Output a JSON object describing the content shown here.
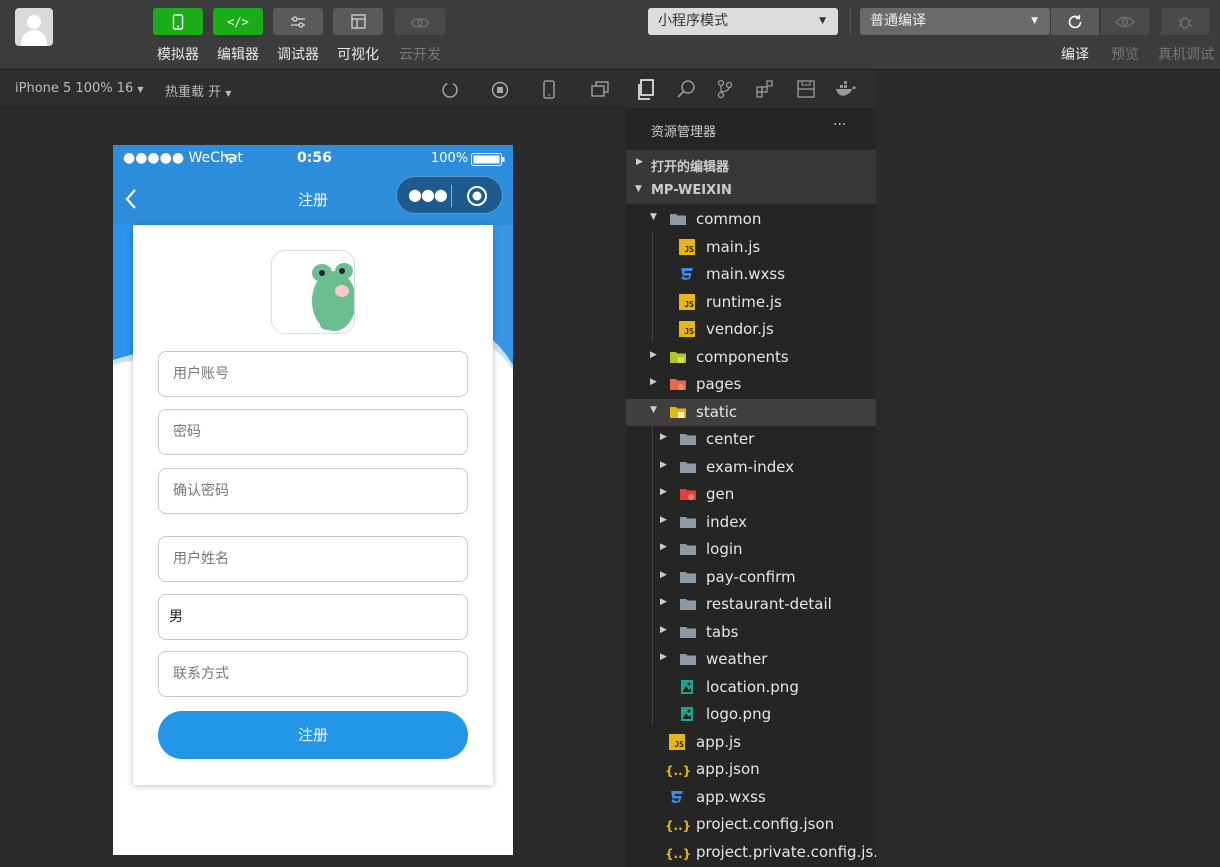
{
  "toolbar": {
    "tools": [
      {
        "label": "模拟器",
        "icon": "phone-icon"
      },
      {
        "label": "编辑器",
        "icon": "code-icon"
      },
      {
        "label": "调试器",
        "icon": "debug-sliders-icon"
      },
      {
        "label": "可视化",
        "icon": "layout-icon"
      },
      {
        "label": "云开发",
        "icon": "cloud-icon"
      }
    ],
    "mode_select": "小程序模式",
    "compile_select": "普通编译",
    "actions": [
      {
        "label": "编译",
        "icon": "refresh-icon"
      },
      {
        "label": "预览",
        "icon": "eye-icon"
      },
      {
        "label": "真机调试",
        "icon": "bug-icon"
      }
    ]
  },
  "simbar": {
    "device": "iPhone 5 100% 16",
    "hot_reload": "热重载 开"
  },
  "phone": {
    "status": {
      "carrier": "●●●●● WeChat",
      "time": "0:56",
      "battery": "100%"
    },
    "nav_title": "注册",
    "fields": [
      {
        "placeholder": "用户账号",
        "value": ""
      },
      {
        "placeholder": "密码",
        "value": ""
      },
      {
        "placeholder": "确认密码",
        "value": ""
      },
      {
        "placeholder": "用户姓名",
        "value": ""
      },
      {
        "placeholder": "",
        "value": "男"
      },
      {
        "placeholder": "联系方式",
        "value": ""
      }
    ],
    "submit": "注册"
  },
  "explorer": {
    "title": "资源管理器",
    "more": "···",
    "open_editors": "打开的编辑器",
    "root": "MP-WEIXIN",
    "items": [
      {
        "name": "common",
        "kind": "folder-open",
        "depth": 1,
        "expanded": true
      },
      {
        "name": "main.js",
        "kind": "js",
        "depth": 2
      },
      {
        "name": "main.wxss",
        "kind": "css",
        "depth": 2
      },
      {
        "name": "runtime.js",
        "kind": "js",
        "depth": 2
      },
      {
        "name": "vendor.js",
        "kind": "js",
        "depth": 2
      },
      {
        "name": "components",
        "kind": "folder-components",
        "depth": 1,
        "expanded": false
      },
      {
        "name": "pages",
        "kind": "folder-pages",
        "depth": 1,
        "expanded": false
      },
      {
        "name": "static",
        "kind": "folder-static",
        "depth": 1,
        "expanded": true,
        "selected": true
      },
      {
        "name": "center",
        "kind": "folder",
        "depth": 2,
        "expanded": false
      },
      {
        "name": "exam-index",
        "kind": "folder",
        "depth": 2,
        "expanded": false
      },
      {
        "name": "gen",
        "kind": "folder-gen",
        "depth": 2,
        "expanded": false
      },
      {
        "name": "index",
        "kind": "folder",
        "depth": 2,
        "expanded": false
      },
      {
        "name": "login",
        "kind": "folder",
        "depth": 2,
        "expanded": false
      },
      {
        "name": "pay-confirm",
        "kind": "folder",
        "depth": 2,
        "expanded": false
      },
      {
        "name": "restaurant-detail",
        "kind": "folder",
        "depth": 2,
        "expanded": false
      },
      {
        "name": "tabs",
        "kind": "folder",
        "depth": 2,
        "expanded": false
      },
      {
        "name": "weather",
        "kind": "folder",
        "depth": 2,
        "expanded": false
      },
      {
        "name": "location.png",
        "kind": "image",
        "depth": 2
      },
      {
        "name": "logo.png",
        "kind": "image",
        "depth": 2
      },
      {
        "name": "app.js",
        "kind": "js",
        "depth": 1
      },
      {
        "name": "app.json",
        "kind": "json",
        "depth": 1
      },
      {
        "name": "app.wxss",
        "kind": "css",
        "depth": 1
      },
      {
        "name": "project.config.json",
        "kind": "json",
        "depth": 1
      },
      {
        "name": "project.private.config.js...",
        "kind": "json",
        "depth": 1
      }
    ]
  }
}
